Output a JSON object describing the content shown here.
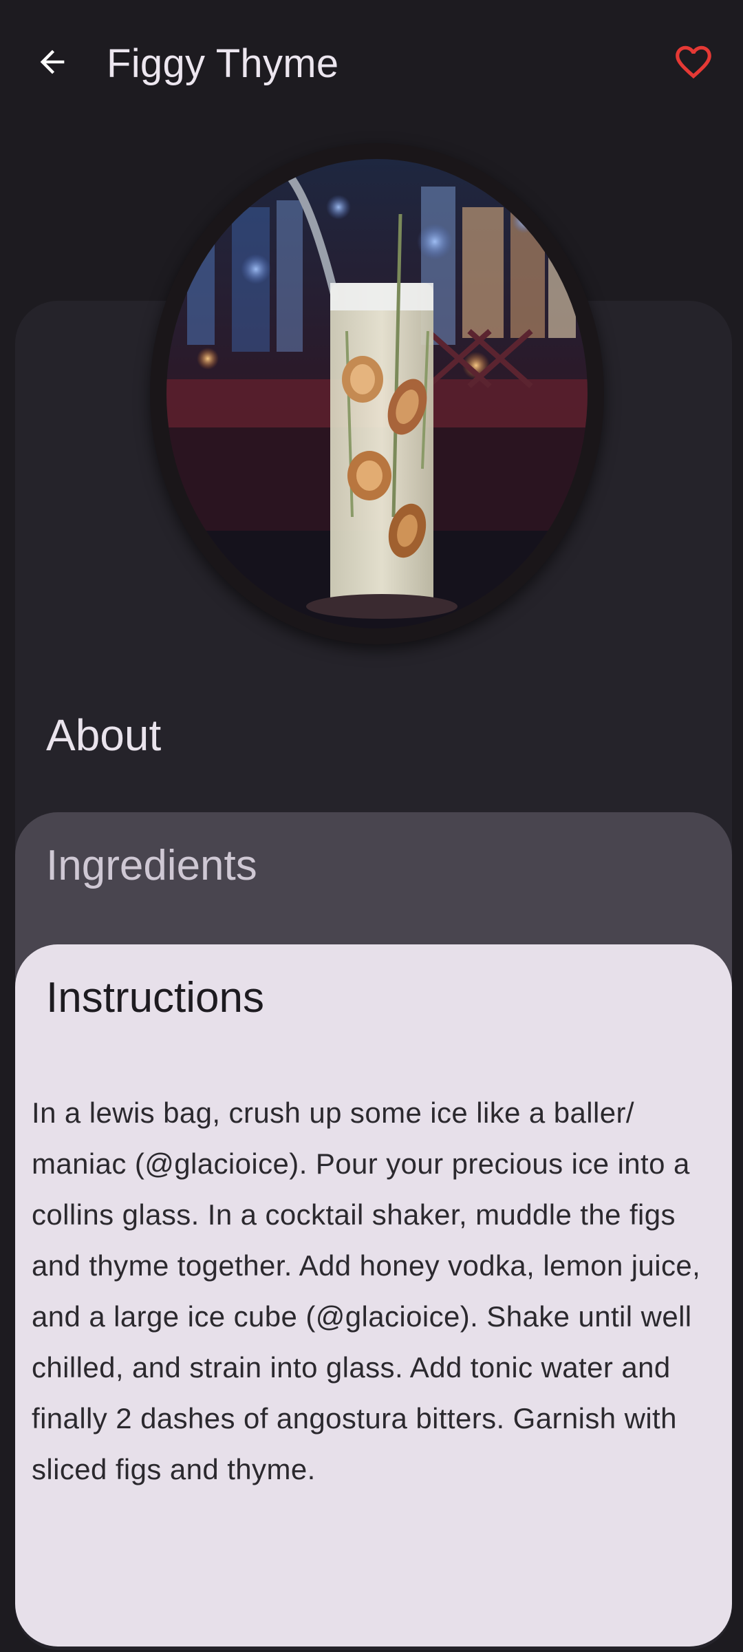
{
  "header": {
    "title": "Figgy Thyme",
    "back_icon": "arrow-left-icon",
    "favorite_icon": "heart-outline-icon",
    "favorite_color": "#e53935"
  },
  "drink_image": {
    "alt": "Figgy Thyme"
  },
  "sections": {
    "about_label": "About",
    "ingredients_label": "Ingredients",
    "instructions_label": "Instructions"
  },
  "instructions": {
    "text": "In a lewis bag, crush up some ice like a baller/ maniac (@glacioice). Pour your precious ice into a collins glass. In a cocktail shaker, muddle the figs and thyme together. Add honey vodka, lemon juice, and a large ice cube (@glacioice). Shake until well chilled, and strain into glass. Add tonic water and finally 2 dashes of angostura bitters. Garnish with sliced figs and thyme."
  },
  "colors": {
    "background": "#1d1b20",
    "surface": "#25232a",
    "ingredients_card": "#49454f",
    "instructions_card": "#e7e0ea"
  }
}
